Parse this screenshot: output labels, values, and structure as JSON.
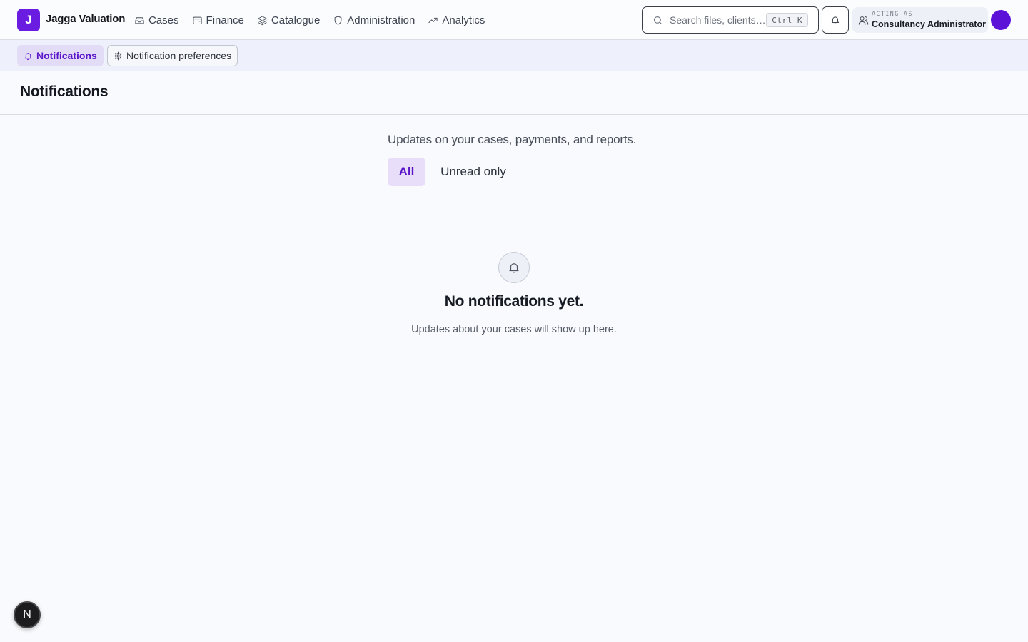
{
  "app": {
    "logo_letter": "J",
    "brand": "Jagga Valuation",
    "accent_color": "#6a1ce0"
  },
  "nav": [
    {
      "label": "Cases",
      "icon": "inbox-icon"
    },
    {
      "label": "Finance",
      "icon": "wallet-icon"
    },
    {
      "label": "Catalogue",
      "icon": "layers-icon"
    },
    {
      "label": "Administration",
      "icon": "shield-icon"
    },
    {
      "label": "Analytics",
      "icon": "trending-up-icon"
    }
  ],
  "search": {
    "placeholder": "Search files, clients…",
    "shortcut": "Ctrl K"
  },
  "acting": {
    "label": "ACTING AS",
    "role": "Consultancy Administrator"
  },
  "subnav": {
    "notifications": "Notifications",
    "preferences": "Notification preferences"
  },
  "page": {
    "title": "Notifications",
    "subtitle": "Updates on your cases, payments, and reports."
  },
  "filters": {
    "all": "All",
    "unread": "Unread only",
    "selected": "All"
  },
  "empty": {
    "title": "No notifications yet.",
    "description": "Updates about your cases will show up here."
  },
  "devtools": {
    "label": "N"
  }
}
